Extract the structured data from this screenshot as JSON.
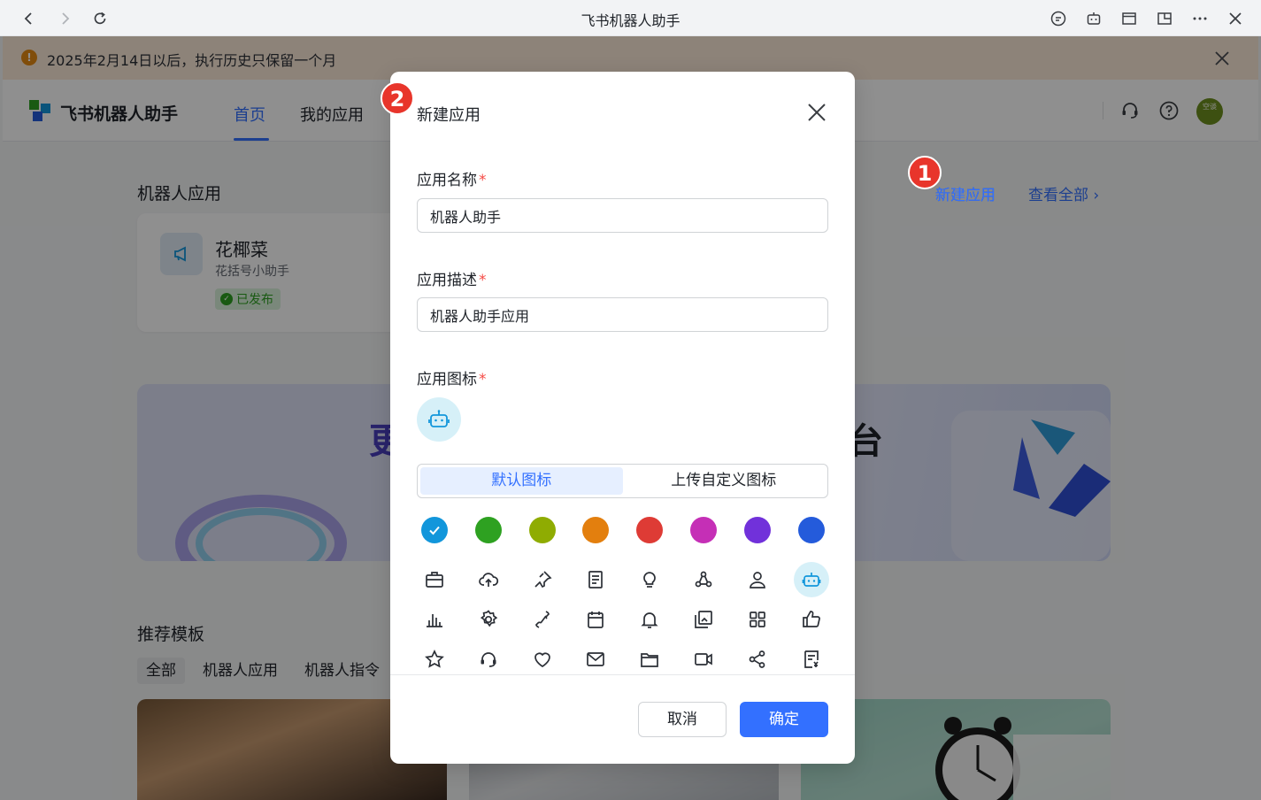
{
  "window": {
    "title": "飞书机器人助手"
  },
  "notice": {
    "text": "2025年2月14日以后，执行历史只保留一个月",
    "icon": "!"
  },
  "header": {
    "app_name": "飞书机器人助手",
    "nav": [
      "首页",
      "我的应用"
    ],
    "avatar_text": "空谈"
  },
  "main": {
    "robot_apps_title": "机器人应用",
    "new_app_link": "新建应用",
    "view_all_link": "查看全部",
    "view_all_chevron": "›",
    "app_card": {
      "title": "花椰菜",
      "subtitle": "花括号小助手",
      "status": "已发布"
    },
    "banner_left_char": "更",
    "banner_right_char": "台",
    "templates_title": "推荐模板",
    "template_tabs": [
      "全部",
      "机器人应用",
      "机器人指令"
    ]
  },
  "modal": {
    "title": "新建应用",
    "name_label": "应用名称",
    "name_value": "机器人助手",
    "desc_label": "应用描述",
    "desc_value": "机器人助手应用",
    "icon_label": "应用图标",
    "required_mark": "*",
    "icon_tabs": [
      "默认图标",
      "上传自定义图标"
    ],
    "colors": [
      "#1296db",
      "#2ea121",
      "#8fac02",
      "#e37f0e",
      "#de3b35",
      "#c52fb6",
      "#7131da",
      "#245bdb"
    ],
    "icons": [
      "briefcase-icon",
      "cloud-upload-icon",
      "pin-icon",
      "document-icon",
      "lightbulb-icon",
      "triangle-nodes-icon",
      "person-icon",
      "robot-icon",
      "bar-chart-icon",
      "gear-icon",
      "phone-icon",
      "calendar-icon",
      "bell-icon",
      "images-icon",
      "grid-icon",
      "thumbs-up-icon",
      "star-icon",
      "headset-icon",
      "heart-icon",
      "mail-icon",
      "folder-icon",
      "video-icon",
      "share-icon",
      "invoice-icon"
    ],
    "cancel_label": "取消",
    "ok_label": "确定"
  },
  "steps": [
    "1",
    "2"
  ]
}
